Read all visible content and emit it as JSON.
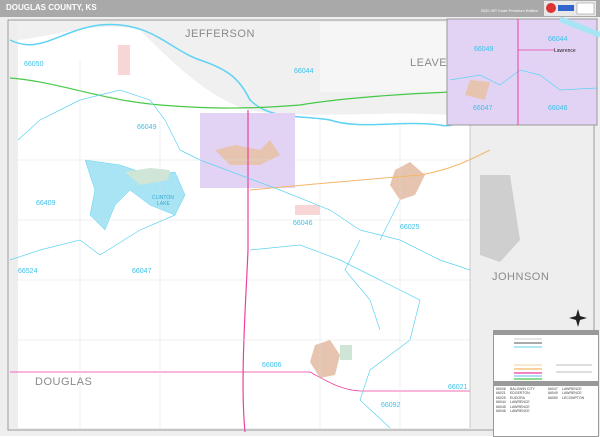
{
  "header": {
    "title": "DOUGLAS COUNTY, KS",
    "edition": "2020 ZIP Code Premium Edition",
    "logo_text": "Maps"
  },
  "counties": {
    "north": "JEFFERSON",
    "northeast": "LEAVE",
    "east": "JOHNSON",
    "main": "DOUGLAS"
  },
  "lake": {
    "label_1": "CLINTON",
    "label_2": "LAKE"
  },
  "zips": [
    "66050",
    "66044",
    "66049",
    "66409",
    "66046",
    "66025",
    "66524",
    "66047",
    "66006",
    "66021",
    "66092"
  ],
  "inset": {
    "city": "Lawrence",
    "zips": [
      "66049",
      "66044",
      "66047",
      "66046"
    ]
  },
  "compass": {
    "icon": "compass-rose-icon"
  },
  "zip_table": {
    "left": [
      {
        "zip": "66006",
        "city": "BALDWIN CITY"
      },
      {
        "zip": "66021",
        "city": "EDGERTON"
      },
      {
        "zip": "66025",
        "city": "EUDORA"
      },
      {
        "zip": "66044",
        "city": "LAWRENCE"
      },
      {
        "zip": "66045",
        "city": "LAWRENCE"
      },
      {
        "zip": "66046",
        "city": "LAWRENCE"
      }
    ],
    "right": [
      {
        "zip": "66047",
        "city": "LAWRENCE"
      },
      {
        "zip": "66049",
        "city": "LAWRENCE"
      },
      {
        "zip": "66050",
        "city": "LECOMPTON"
      }
    ]
  },
  "colors": {
    "zip_boundary": "#5fd3f3",
    "water": "#a9e4f5",
    "highway": "#47c847",
    "us_route": "#ee3fa0",
    "state_route": "#f5b66a",
    "city": "#e2d3f5",
    "outside": "#eeeeee",
    "header": "#a9a9a9"
  }
}
